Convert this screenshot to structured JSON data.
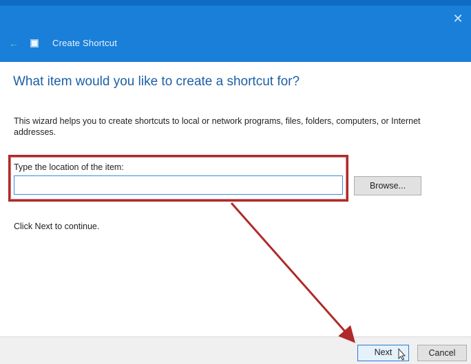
{
  "window": {
    "title": "Create Shortcut",
    "close_glyph": "✕",
    "back_glyph": "←"
  },
  "main": {
    "heading": "What item would you like to create a shortcut for?",
    "description": "This wizard helps you to create shortcuts to local or network programs, files, folders, computers, or Internet addresses.",
    "location_label": "Type the location of the item:",
    "location_value": "",
    "browse_label": "Browse...",
    "continue_text": "Click Next to continue."
  },
  "footer": {
    "next_label": "Next",
    "cancel_label": "Cancel"
  },
  "annotation": {
    "color": "#b02a2a"
  },
  "colors": {
    "titlebar": "#1a7fd8",
    "heading": "#1c5fa6",
    "input_border": "#3a8be0"
  },
  "icons": {
    "back": "back-arrow-icon",
    "app": "shortcut-app-icon",
    "close": "close-icon",
    "cursor": "mouse-pointer-icon"
  }
}
